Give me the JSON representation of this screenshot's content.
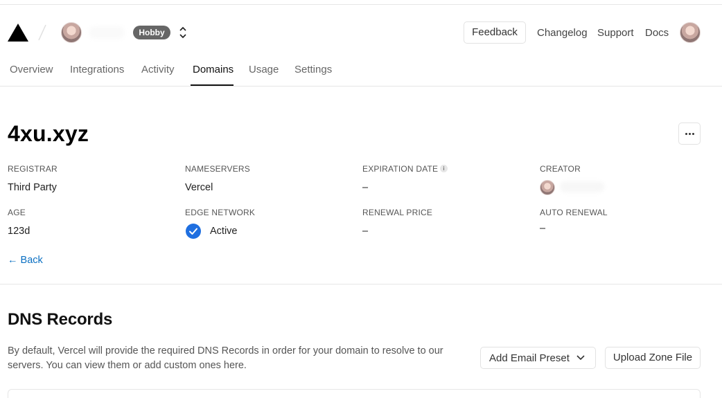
{
  "header": {
    "team_badge": "Hobby",
    "feedback_label": "Feedback",
    "links": [
      "Changelog",
      "Support",
      "Docs"
    ]
  },
  "tabs": [
    {
      "label": "Overview",
      "active": false
    },
    {
      "label": "Integrations",
      "active": false
    },
    {
      "label": "Activity",
      "active": false
    },
    {
      "label": "Domains",
      "active": true
    },
    {
      "label": "Usage",
      "active": false
    },
    {
      "label": "Settings",
      "active": false
    }
  ],
  "domain": {
    "name": "4xu.xyz",
    "fields": {
      "registrar": {
        "label": "REGISTRAR",
        "value": "Third Party"
      },
      "nameservers": {
        "label": "NAMESERVERS",
        "value": "Vercel"
      },
      "expiration_date": {
        "label": "EXPIRATION DATE",
        "value": "–"
      },
      "creator": {
        "label": "CREATOR"
      },
      "age": {
        "label": "AGE",
        "value": "123d"
      },
      "edge_network": {
        "label": "EDGE NETWORK",
        "value": "Active"
      },
      "renewal_price": {
        "label": "RENEWAL PRICE",
        "value": "–"
      },
      "auto_renewal": {
        "label": "AUTO RENEWAL",
        "value": "–"
      }
    },
    "back_label": "← Back"
  },
  "dns": {
    "title": "DNS Records",
    "description": "By default, Vercel will provide the required DNS Records in order for your domain to resolve to our servers. You can view them or add custom ones here.",
    "add_email_preset_label": "Add Email Preset",
    "upload_zone_file_label": "Upload Zone File"
  },
  "colors": {
    "accent_link": "#0a6fc2",
    "active_check": "#1f6fe0",
    "badge_bg": "#666666"
  },
  "icons": {
    "logo": "vercel-triangle-icon",
    "switcher": "chevron-up-down-icon",
    "more": "ellipsis-icon",
    "info": "info-icon",
    "edge_status": "check-circle-icon",
    "dropdown": "chevron-down-icon"
  }
}
